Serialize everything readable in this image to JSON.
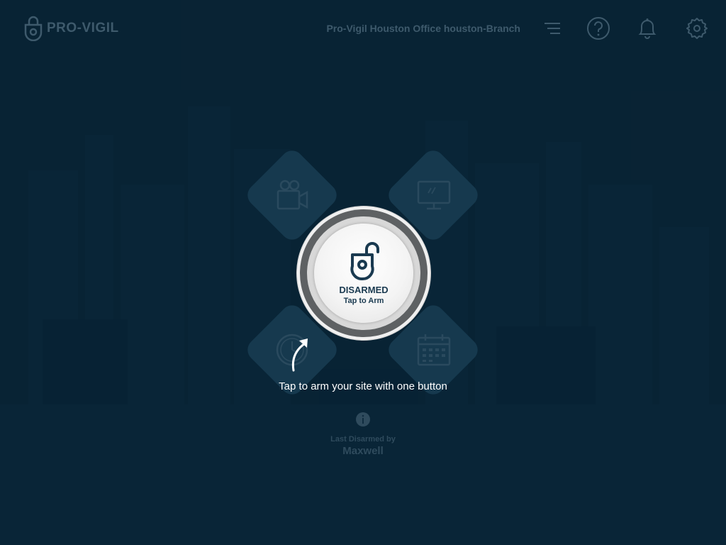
{
  "header": {
    "brand": "PRO-VIGIL",
    "site_name": "Pro-Vigil Houston Office houston-Branch",
    "icons": [
      "menu-icon",
      "help-icon",
      "bell-icon",
      "settings-icon"
    ]
  },
  "tiles": [
    {
      "icon": "video-camera-icon"
    },
    {
      "icon": "monitor-icon"
    },
    {
      "icon": "clock-icon"
    },
    {
      "icon": "calendar-icon"
    }
  ],
  "arm_button": {
    "status": "DISARMED",
    "action": "Tap to Arm",
    "icon": "unlocked-shield-icon"
  },
  "hint": "Tap to arm your site with one button",
  "last_event": {
    "label": "Last Disarmed by",
    "user": "Maxwell"
  },
  "colors": {
    "background": "#0f2c3f",
    "tile": "#16394e",
    "muted_text": "#3e5a6c",
    "button_text": "#1a3a50"
  }
}
